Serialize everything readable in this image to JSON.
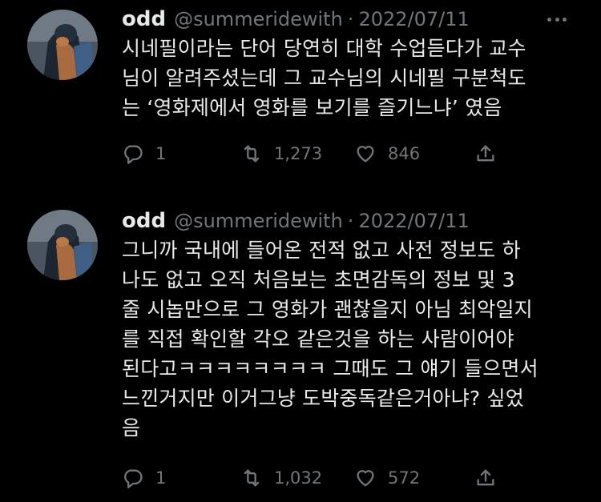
{
  "tweets": [
    {
      "name": "odd",
      "handle": "@summeridewith",
      "separator": "·",
      "date": "2022/07/11",
      "text": "시네필이라는 단어 당연히 대학 수업듣다가 교수\n님이 알려주셨는데 그 교수님의 시네필 구분척도\n는 ‘영화제에서 영화를 보기를 즐기느냐’ 였음",
      "replies": "1",
      "retweets": "1,273",
      "likes": "846",
      "icons": {
        "reply": "reply-icon",
        "retweet": "retweet-icon",
        "like": "heart-icon",
        "share": "share-icon",
        "more": "more-icon"
      }
    },
    {
      "name": "odd",
      "handle": "@summeridewith",
      "separator": "·",
      "date": "2022/07/11",
      "text": "그니까 국내에 들어온 전적 없고 사전 정보도 하\n나도 없고 오직 처음보는 초면감독의 정보 및 3\n줄 시놉만으로 그 영화가 괜찮을지 아님 최악일지\n를 직접 확인할 각오 같은것을 하는 사람이어야\n된다고ㅋㅋㅋㅋㅋㅋㅋㅋ 그때도 그 얘기 들으면서\n느낀거지만 이거그냥 도박중독같은거아냐? 싶었\n음",
      "replies": "1",
      "retweets": "1,032",
      "likes": "572",
      "icons": {
        "reply": "reply-icon",
        "retweet": "retweet-icon",
        "like": "heart-icon",
        "share": "share-icon",
        "more": "more-icon"
      }
    }
  ],
  "colors": {
    "background": "#000000",
    "text": "#e7e9ea",
    "secondary": "#71767b"
  }
}
